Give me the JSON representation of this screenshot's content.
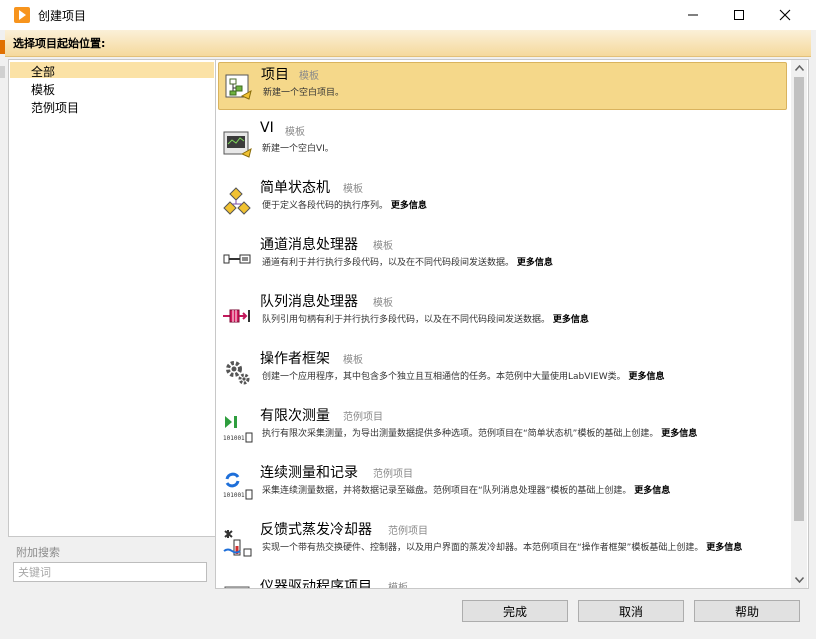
{
  "window": {
    "title": "创建项目",
    "minimize_glyph": "—",
    "maximize_glyph": "☐",
    "close_glyph": "✕"
  },
  "banner": {
    "text": "选择项目起始位置:"
  },
  "categories": [
    {
      "label": "全部",
      "selected": true
    },
    {
      "label": "模板",
      "selected": false
    },
    {
      "label": "范例项目",
      "selected": false
    }
  ],
  "search": {
    "label": "附加搜索",
    "placeholder": "关键词"
  },
  "templates": [
    {
      "name": "项目",
      "kind": "模板",
      "desc": "新建一个空白项目。",
      "more": "",
      "icon": "project-icon",
      "selected": true
    },
    {
      "name": "VI",
      "kind": "模板",
      "desc": "新建一个空白VI。",
      "more": "",
      "icon": "vi-icon",
      "selected": false
    },
    {
      "name": "简单状态机",
      "kind": "模板",
      "desc": "便于定义各段代码的执行序列。",
      "more": "更多信息",
      "icon": "state-machine-icon",
      "selected": false
    },
    {
      "name": "通道消息处理器",
      "kind": "模板",
      "desc": "通道有利于并行执行多段代码，以及在不同代码段间发送数据。",
      "more": "更多信息",
      "icon": "channel-handler-icon",
      "selected": false
    },
    {
      "name": "队列消息处理器",
      "kind": "模板",
      "desc": "队列引用句柄有利于并行执行多段代码，以及在不同代码段间发送数据。",
      "more": "更多信息",
      "icon": "queue-handler-icon",
      "selected": false
    },
    {
      "name": "操作者框架",
      "kind": "模板",
      "desc": "创建一个应用程序，其中包含多个独立且互相通信的任务。本范例中大量使用LabVIEW类。",
      "more": "更多信息",
      "icon": "gears-icon",
      "selected": false
    },
    {
      "name": "有限次测量",
      "kind": "范例项目",
      "desc": "执行有限次采集测量，为导出测量数据提供多种选项。范例项目在“简单状态机”模板的基础上创建。",
      "more": "更多信息",
      "icon": "finite-measurement-icon",
      "selected": false
    },
    {
      "name": "连续测量和记录",
      "kind": "范例项目",
      "desc": "采集连续测量数据，并将数据记录至磁盘。范例项目在“队列消息处理器”模板的基础上创建。",
      "more": "更多信息",
      "icon": "continuous-measurement-icon",
      "selected": false
    },
    {
      "name": "反馈式蒸发冷却器",
      "kind": "范例项目",
      "desc": "实现一个带有热交换硬件、控制器，以及用户界面的蒸发冷却器。本范例项目在“操作者框架”模板基础上创建。",
      "more": "更多信息",
      "icon": "evaporative-cooler-icon",
      "selected": false
    },
    {
      "name": "仪器驱动程序项目",
      "kind": "模板",
      "desc": "",
      "more": "",
      "icon": "instrument-driver-icon",
      "selected": false
    }
  ],
  "buttons": {
    "finish": "完成",
    "cancel": "取消",
    "help": "帮助"
  }
}
